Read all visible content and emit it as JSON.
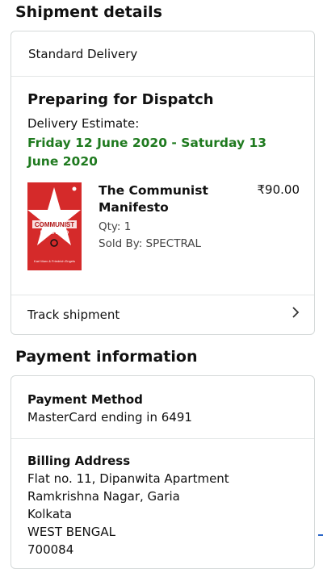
{
  "shipment": {
    "title": "Shipment details",
    "delivery_type": "Standard Delivery",
    "status": "Preparing for Dispatch",
    "estimate_label": "Delivery Estimate:",
    "estimate_date": "Friday 12 June 2020 - Saturday 13 June 2020",
    "item": {
      "title": "The Communist Manifesto",
      "price": "₹90.00",
      "qty": "Qty: 1",
      "seller": "Sold By: SPECTRAL",
      "thumbnail_text": "COMMUNIST MANIFESTO",
      "thumbnail_author": "Karl Marx & Friedrich Engels"
    },
    "track_label": "Track shipment",
    "track_icon": "chevron-right-icon"
  },
  "payment": {
    "title": "Payment information",
    "method_label": "Payment Method",
    "method_value": "MasterCard ending in 6491",
    "billing_label": "Billing Address",
    "billing_lines": [
      "Flat no. 11, Dipanwita Apartment",
      "Ramkrishna Nagar, Garia",
      "Kolkata",
      "WEST BENGAL",
      "700084"
    ]
  },
  "colors": {
    "estimate_green": "#1f7a1f",
    "border": "#d5d9d9",
    "book_red": "#d52a2a"
  }
}
